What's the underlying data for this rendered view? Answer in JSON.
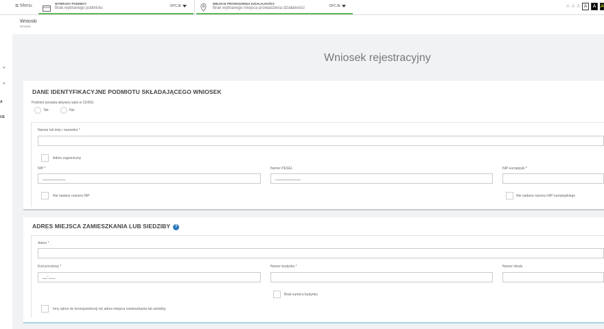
{
  "topbar": {
    "menu_label": "Menu",
    "subject_label": "WYBRANY PODMIOT:",
    "subject_value": "Brak wybranego podmiotu",
    "subject_options": "OPCJE",
    "place_label": "MIEJSCE PROWADZENIA DZIAŁALNOŚCI:",
    "place_value": "Brak wybranego miejsca prowadzenia działalności",
    "place_options": "OPCJE",
    "a11y": [
      "A",
      "A",
      "A",
      "A",
      "A",
      "A"
    ]
  },
  "sidebar": {
    "items": [
      "˅",
      "˅",
      "A",
      "UE"
    ]
  },
  "breadcrumb": {
    "title": "Wnioski",
    "sub": "Wnioski"
  },
  "form": {
    "title": "Wniosek rejestracyjny",
    "section1": {
      "title": "DANE IDENTYFIKACYJNE PODMIOTU SKŁADAJĄCEGO WNIOSEK",
      "ceidg_question": "Podmiot posiada aktywny wpis w CEIDG",
      "yes": "Tak",
      "no": "Nie",
      "name_label": "Nazwa lub imię i nazwisko *",
      "foreign_address": "Adres zagraniczny",
      "nip_label": "NIP *",
      "nip_mask": "__________",
      "pesel_label": "Numer PESEL",
      "pesel_mask": "___________",
      "eu_nip_label": "NIP europejski *",
      "no_nip": "Nie nadano numeru NIP",
      "no_eu_nip": "Nie nadano numeru NIP europejskiego"
    },
    "section2": {
      "title": "ADRES MIEJSCA ZAMIESZKANIA LUB SIEDZIBY",
      "help": "?",
      "address_label": "Adres *",
      "postal_label": "Kod pocztowy *",
      "postal_mask": "__-___",
      "building_label": "Numer budynku *",
      "flat_label": "Numer lokalu",
      "no_building": "Brak numeru budynku",
      "other_correspondence": "Inny adres do korespondencji niż adres miejsca zamieszkania lub siedziby"
    }
  }
}
